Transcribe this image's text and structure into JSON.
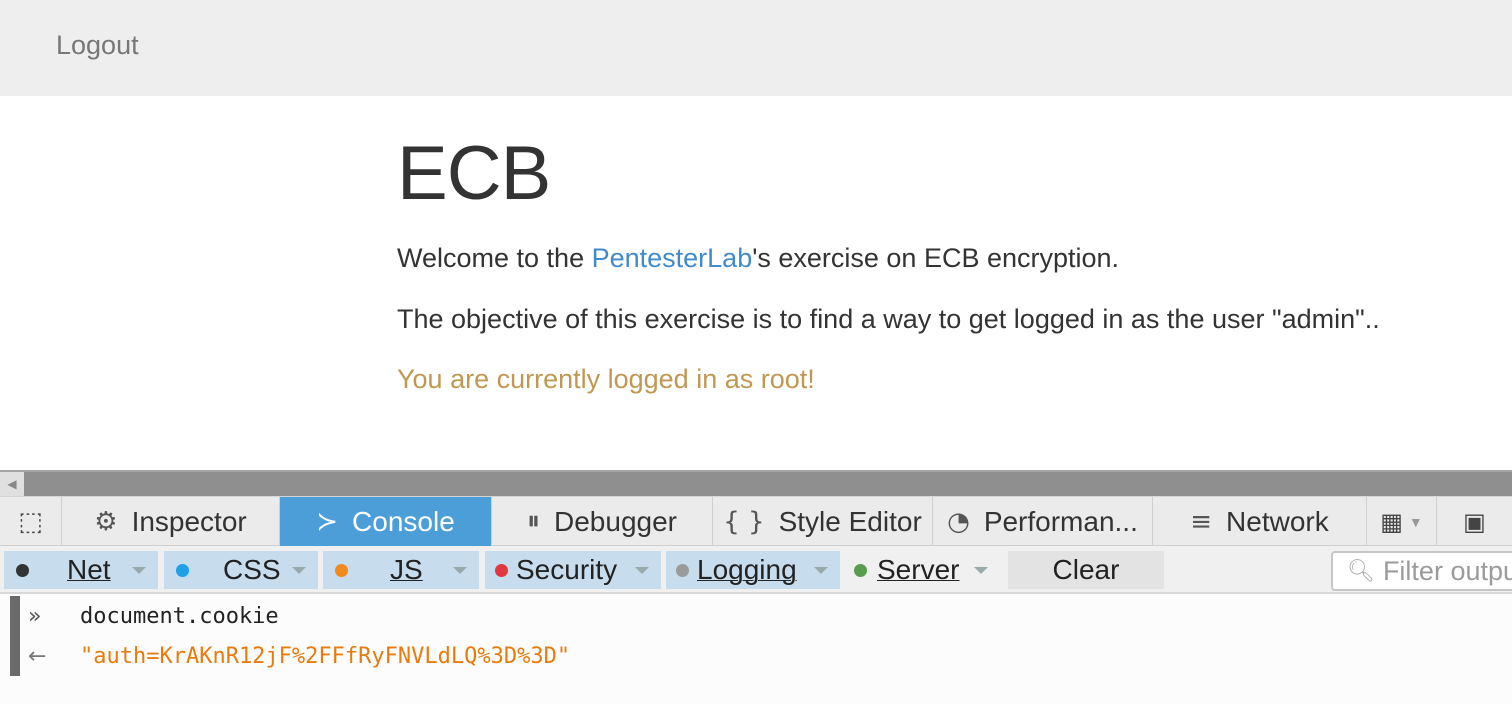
{
  "navbar": {
    "logout_label": "Logout"
  },
  "content": {
    "title": "ECB",
    "welcome_prefix": "Welcome to the ",
    "welcome_link": "PentesterLab",
    "welcome_suffix": "'s exercise on ECB encryption.",
    "objective": "The objective of this exercise is to find a way to get logged in as the user \"admin\"..",
    "status": "You are currently logged in as root!"
  },
  "devtools": {
    "tabs": [
      {
        "label": "Inspector",
        "icon": "gear-icon"
      },
      {
        "label": "Console",
        "icon": "console-prompt-icon"
      },
      {
        "label": "Debugger",
        "icon": "pause-icon"
      },
      {
        "label": "Style Editor",
        "icon": "braces-icon"
      },
      {
        "label": "Performan...",
        "icon": "gauge-icon"
      },
      {
        "label": "Network",
        "icon": "network-icon"
      }
    ],
    "filters": [
      {
        "label": "Net",
        "color": "#333333"
      },
      {
        "label": "CSS",
        "color": "#1ea1e6"
      },
      {
        "label": "JS",
        "color": "#f08a1c"
      },
      {
        "label": "Security",
        "color": "#e0383e"
      },
      {
        "label": "Logging",
        "color": "#9a9a9a"
      },
      {
        "label": "Server",
        "color": "#5a9c4f"
      }
    ],
    "clear_label": "Clear",
    "filter_placeholder": "Filter output",
    "console": {
      "input": "document.cookie",
      "output": "\"auth=KrAKnR12jF%2FFfRyFNVLdLQ%3D%3D\""
    }
  }
}
